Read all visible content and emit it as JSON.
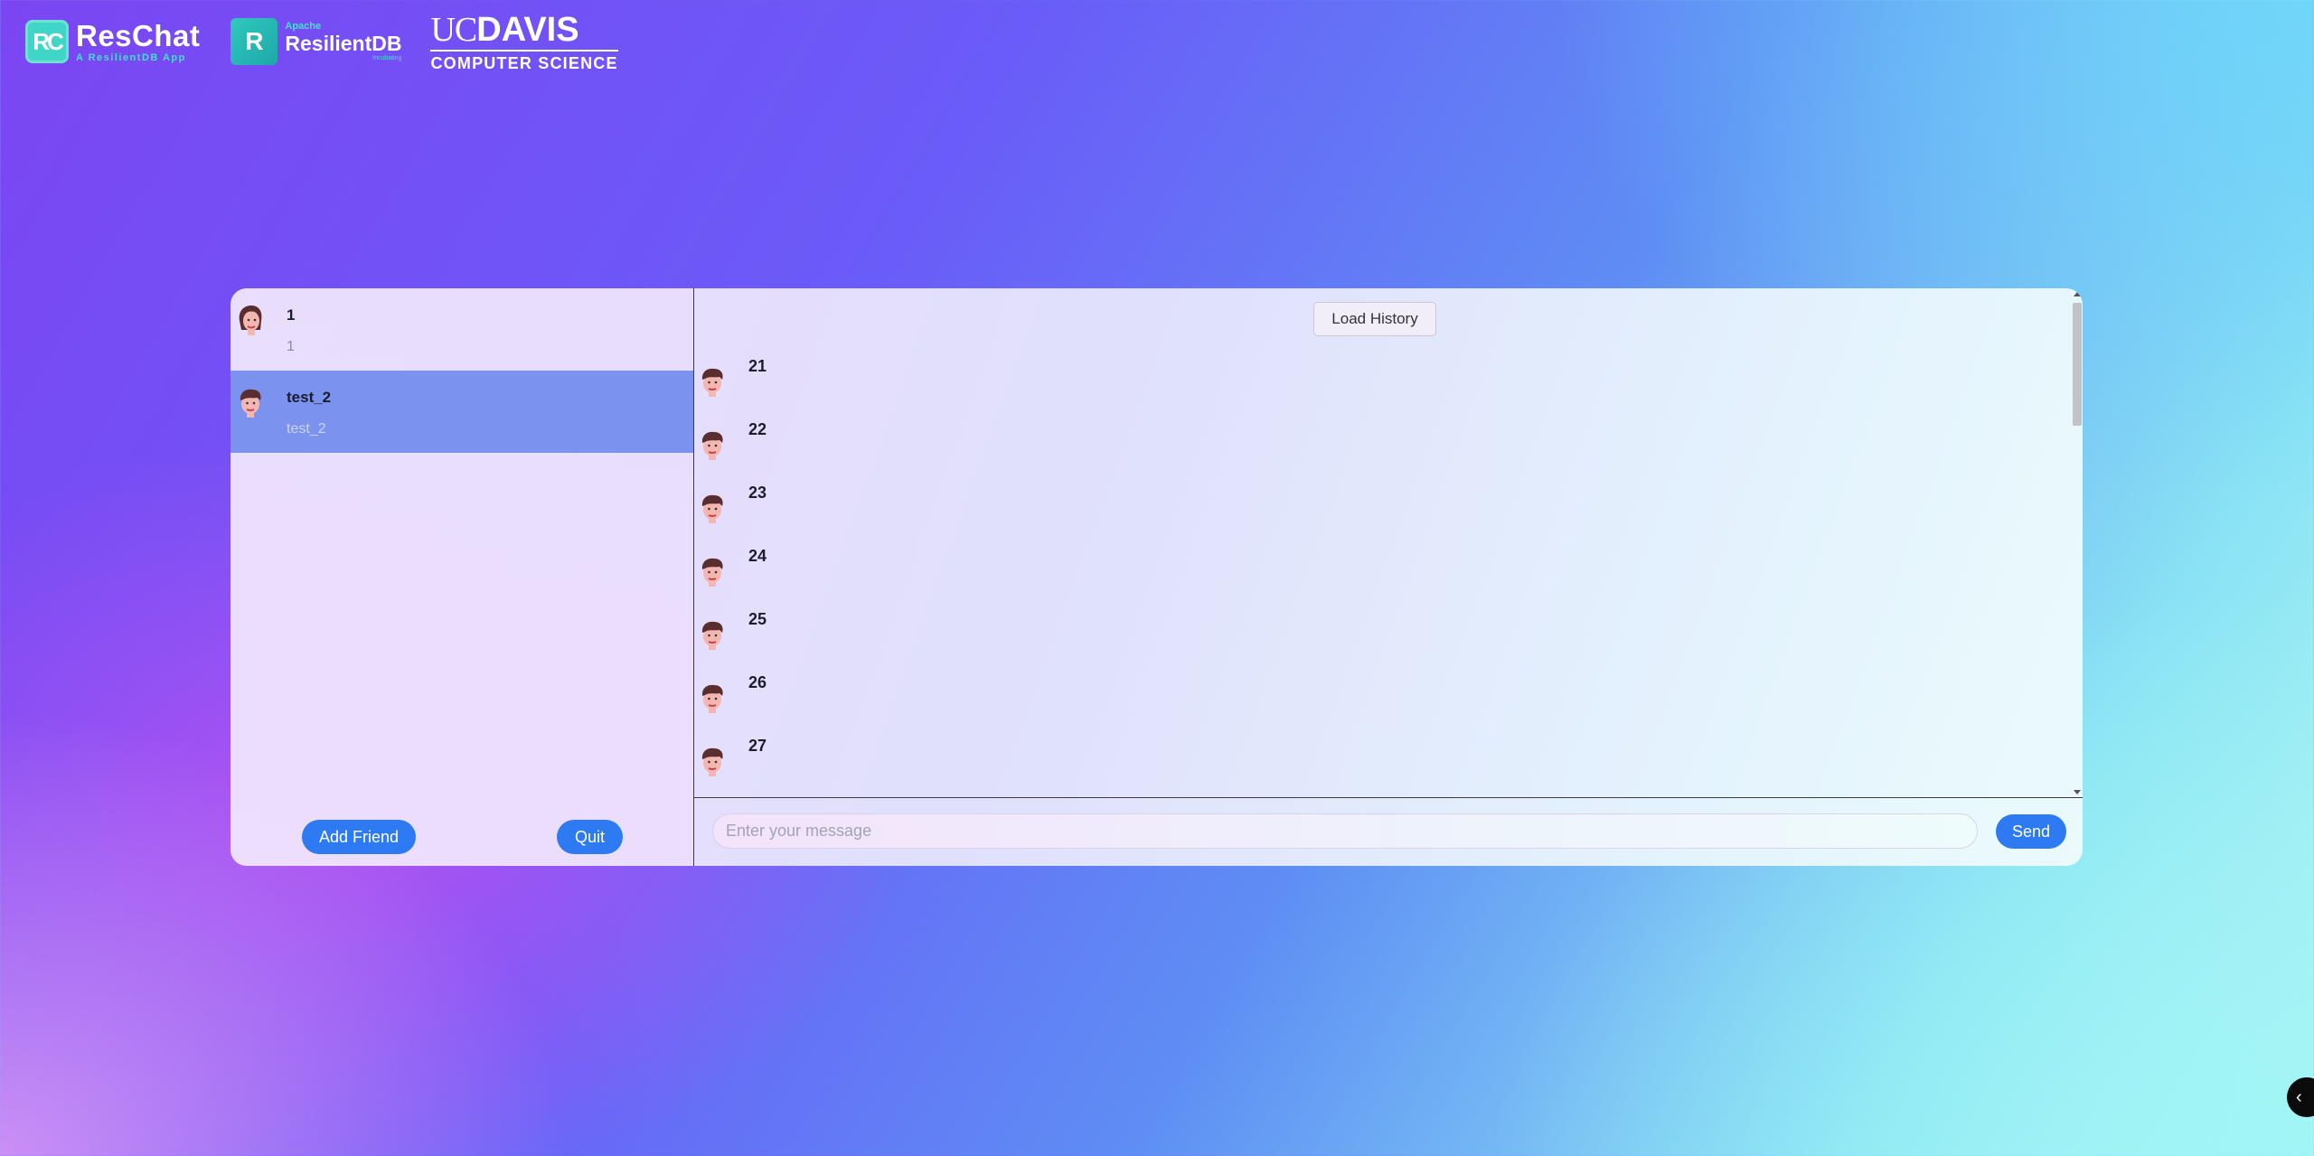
{
  "header": {
    "reschat": {
      "mark": "RC",
      "title": "ResChat",
      "subtitle": "A ResilientDB App"
    },
    "resilientdb": {
      "mark": "R",
      "apache": "Apache",
      "title": "ResilientDB",
      "incubating": "Incubating"
    },
    "ucdavis": {
      "uc": "UC",
      "davis": "DAVIS",
      "subtitle": "COMPUTER SCIENCE"
    }
  },
  "friends": [
    {
      "name": "1",
      "subtitle": "1",
      "avatar": "female-avatar-icon",
      "active": false
    },
    {
      "name": "test_2",
      "subtitle": "test_2",
      "avatar": "male-avatar-icon",
      "active": true
    }
  ],
  "friend_actions": {
    "add_friend": "Add Friend",
    "quit": "Quit"
  },
  "chat": {
    "load_history": "Load History",
    "messages": [
      "21",
      "22",
      "23",
      "24",
      "25",
      "26",
      "27"
    ],
    "input_placeholder": "Enter your message",
    "send": "Send"
  },
  "corner_button": {
    "icon": "chevron-left-icon",
    "glyph": "‹"
  },
  "colors": {
    "accent": "#2d7af2",
    "active_row": "#7b92ee",
    "logo_teal": "#3fd6c8"
  }
}
